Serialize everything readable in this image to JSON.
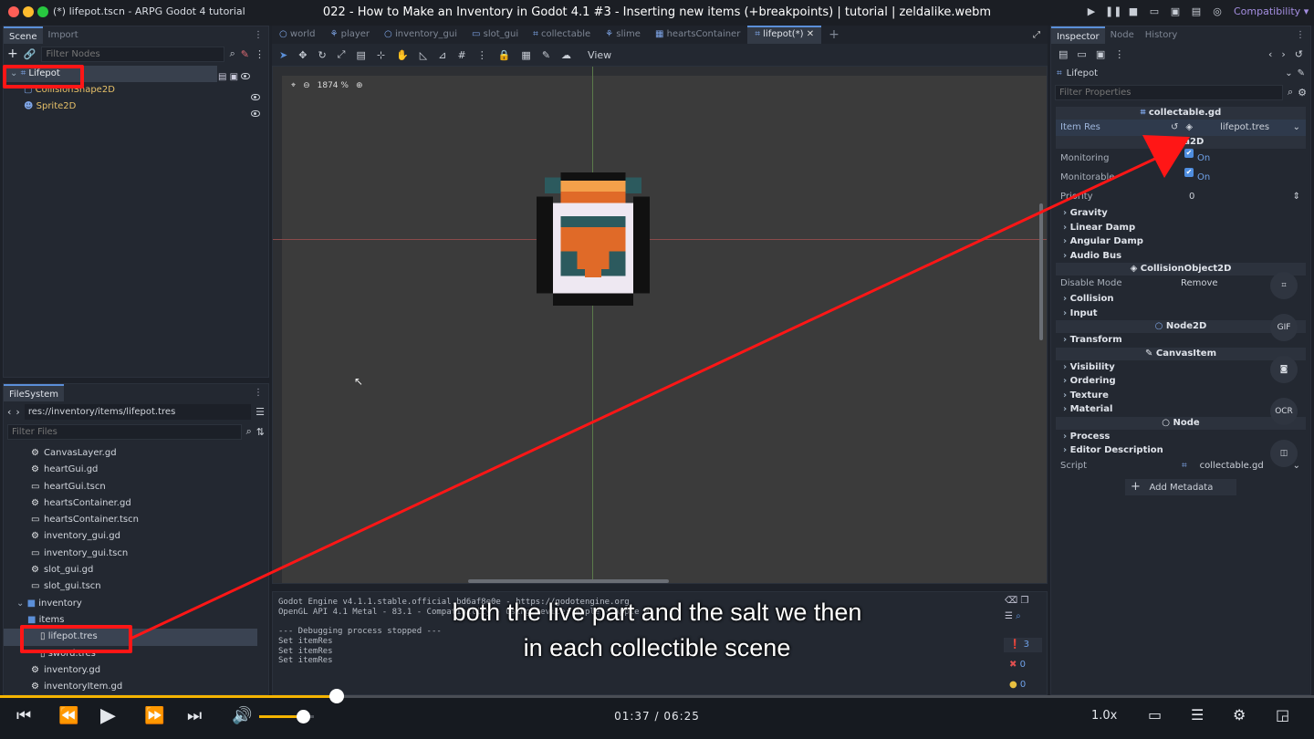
{
  "window": {
    "title": "(*) lifepot.tscn - ARPG Godot 4 tutorial",
    "compat": "Compatibility ▾"
  },
  "video": {
    "title": "022 - How to Make an Inventory in Godot 4.1 #3 - Inserting new items (+breakpoints) | tutorial | zeldalike.webm",
    "time": "01:37 / 06:25",
    "speed": "1.0x",
    "progress": 0.256,
    "volume": 0.8,
    "subtitle1": "both the live part and the salt we then",
    "subtitle2": "in each collectible scene"
  },
  "scene_dock": {
    "tabs": [
      "Scene",
      "Import"
    ],
    "filter_placeholder": "Filter Nodes",
    "nodes": [
      {
        "label": "Lifepot"
      },
      {
        "label": "CollisionShape2D"
      },
      {
        "label": "Sprite2D"
      }
    ]
  },
  "filesystem": {
    "tab": "FileSystem",
    "path": "res://inventory/items/lifepot.tres",
    "filter_placeholder": "Filter Files",
    "files": [
      "CanvasLayer.gd",
      "heartGui.gd",
      "heartGui.tscn",
      "heartsContainer.gd",
      "heartsContainer.tscn",
      "inventory_gui.gd",
      "inventory_gui.tscn",
      "slot_gui.gd",
      "slot_gui.tscn"
    ],
    "folder_inventory": "inventory",
    "folder_items": "items",
    "selected_file": "lifepot.tres",
    "sword_file": "sword.tres",
    "inv_gd": "inventory.gd",
    "inv_item": "inventoryItem.gd"
  },
  "editor_tabs": [
    "world",
    "player",
    "inventory_gui",
    "slot_gui",
    "collectable",
    "slime",
    "heartsContainer",
    "lifepot(*)"
  ],
  "viewport": {
    "zoom": "1874 %",
    "view_label": "View"
  },
  "output": {
    "lines": [
      "Godot Engine v4.1.1.stable.official.bd6af8e0e - https://godotengine.org",
      "OpenGL API 4.1 Metal - 83.1 - Compatibility - Using Device: Apple - Apple M1",
      "",
      "--- Debugging process stopped ---",
      "Set itemRes",
      "Set itemRes",
      "Set itemRes"
    ],
    "count_msg": "3",
    "count_err": "0",
    "count_warn": "0"
  },
  "inspector": {
    "tabs": [
      "Inspector",
      "Node",
      "History"
    ],
    "object": "Lifepot",
    "filter_placeholder": "Filter Properties",
    "script_header": "collectable.gd",
    "item_res_label": "Item Res",
    "item_res_value": "lifepot.tres",
    "area_header": "Area2D",
    "monitoring_label": "Monitoring",
    "monitoring_value": "On",
    "monitorable_label": "Monitorable",
    "monitorable_value": "On",
    "priority_label": "Priority",
    "priority_value": "0",
    "groups1": [
      "Gravity",
      "Linear Damp",
      "Angular Damp",
      "Audio Bus"
    ],
    "collision_obj_header": "CollisionObject2D",
    "disable_mode_label": "Disable Mode",
    "disable_mode_value": "Remove",
    "groups2": [
      "Collision",
      "Input"
    ],
    "node2d_header": "Node2D",
    "groups3": [
      "Transform"
    ],
    "canvas_header": "CanvasItem",
    "groups4": [
      "Visibility",
      "Ordering",
      "Texture",
      "Material"
    ],
    "node_header": "Node",
    "groups5": [
      "Process",
      "Editor Description"
    ],
    "script_label": "Script",
    "script_value": "collectable.gd",
    "add_metadata": "Add Metadata"
  },
  "side_buttons": [
    "GIF",
    "OCR"
  ]
}
